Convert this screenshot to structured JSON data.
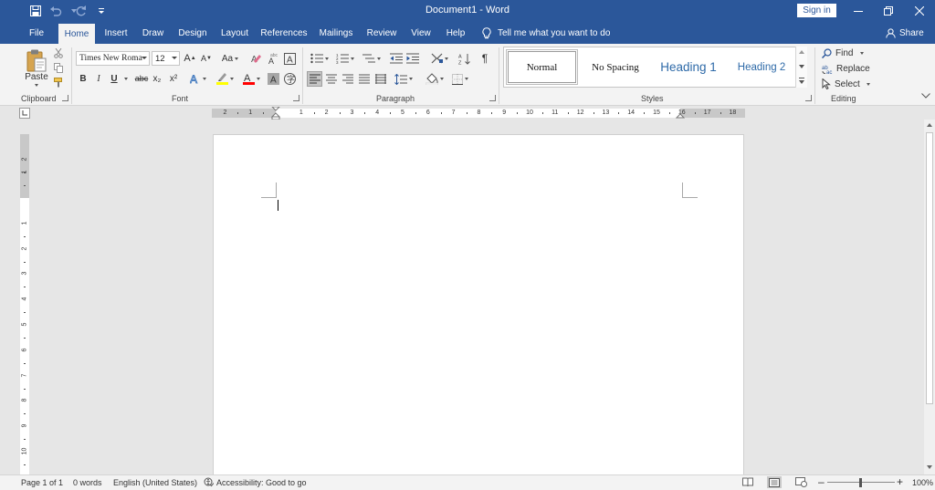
{
  "title_bar": {
    "document_title": "Document1  -  Word",
    "sign_in_label": "Sign in",
    "quick_access": [
      "save-icon",
      "undo-icon",
      "redo-icon",
      "customize-qat-icon"
    ],
    "window_controls": [
      "minimize-icon",
      "restore-icon",
      "close-icon"
    ]
  },
  "tabs": [
    {
      "label": "File"
    },
    {
      "label": "Home",
      "active": true
    },
    {
      "label": "Insert"
    },
    {
      "label": "Draw"
    },
    {
      "label": "Design"
    },
    {
      "label": "Layout"
    },
    {
      "label": "References"
    },
    {
      "label": "Mailings"
    },
    {
      "label": "Review"
    },
    {
      "label": "View"
    },
    {
      "label": "Help"
    }
  ],
  "tell_me": "Tell me what you want to do",
  "share_label": "Share",
  "ribbon": {
    "clipboard": {
      "label": "Clipboard",
      "paste_label": "Paste"
    },
    "font": {
      "label": "Font",
      "font_name": "Times New Roma",
      "font_size": "12",
      "bold": "B",
      "italic": "I",
      "underline": "U",
      "strike": "abc",
      "subscript": "x₂",
      "superscript": "x²",
      "change_case": "Aa",
      "grow": "A",
      "shrink": "A",
      "highlight_color": "#ffff00",
      "font_color": "#ff0000"
    },
    "paragraph": {
      "label": "Paragraph",
      "pilcrow": "¶"
    },
    "styles": {
      "label": "Styles",
      "items": [
        {
          "name": "Normal",
          "selected": true
        },
        {
          "name": "No Spacing"
        },
        {
          "name": "Heading 1"
        },
        {
          "name": "Heading 2"
        }
      ]
    },
    "editing": {
      "label": "Editing",
      "find": "Find",
      "replace": "Replace",
      "select": "Select"
    }
  },
  "ruler": {
    "horizontal_numbers": [
      "2",
      "1",
      "1",
      "2",
      "3",
      "4",
      "5",
      "6",
      "7",
      "8",
      "9",
      "10",
      "11",
      "12",
      "13",
      "14",
      "15",
      "16",
      "17",
      "18"
    ],
    "vertical_numbers": [
      "2",
      "1",
      "1",
      "2",
      "3",
      "4",
      "5",
      "6",
      "7",
      "8",
      "9",
      "10"
    ]
  },
  "status_bar": {
    "page": "Page 1 of 1",
    "words": "0 words",
    "language": "English (United States)",
    "accessibility": "Accessibility: Good to go",
    "zoom": "100%"
  },
  "colors": {
    "accent": "#2b579a",
    "ribbon_bg": "#f3f3f3",
    "canvas_bg": "#e6e6e6"
  }
}
